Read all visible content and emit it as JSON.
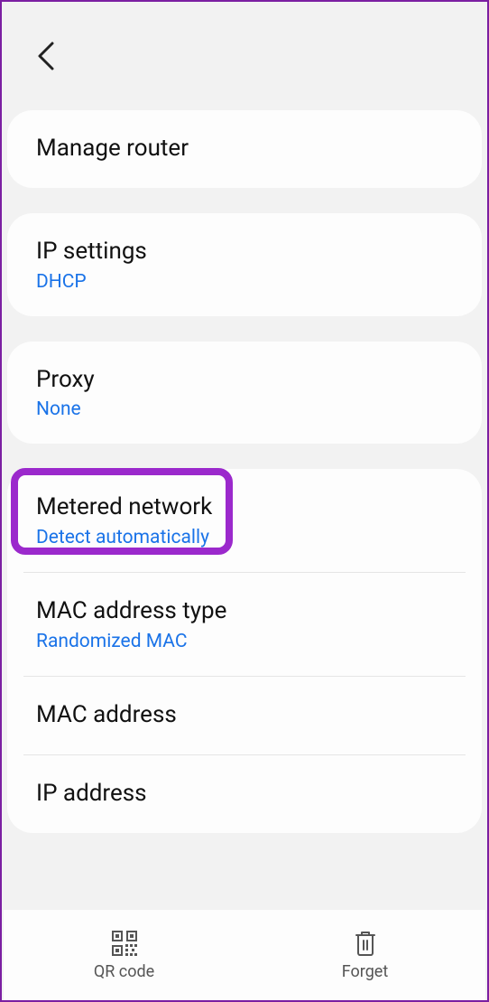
{
  "rows": {
    "manage_router": {
      "title": "Manage router"
    },
    "ip_settings": {
      "title": "IP settings",
      "sub": "DHCP"
    },
    "proxy": {
      "title": "Proxy",
      "sub": "None"
    },
    "metered": {
      "title": "Metered network",
      "sub": "Detect automatically"
    },
    "mac_type": {
      "title": "MAC address type",
      "sub": "Randomized MAC"
    },
    "mac_addr": {
      "title": "MAC address"
    },
    "ip_addr": {
      "title": "IP address"
    }
  },
  "footer": {
    "qr": "QR code",
    "forget": "Forget"
  }
}
